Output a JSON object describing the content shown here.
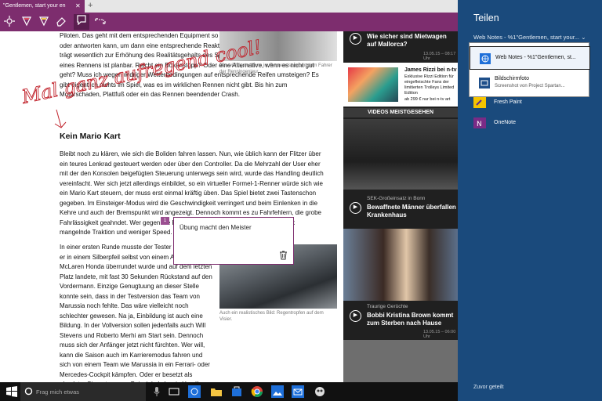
{
  "browser": {
    "tab_title": "\"Gentlemen, start your en",
    "tab_close": "✕",
    "new_tab": "+"
  },
  "toolbar": {
    "icons": [
      "pan-icon",
      "pen-icon",
      "highlighter-icon",
      "eraser-icon",
      "note-icon",
      "clip-icon"
    ]
  },
  "article": {
    "p1": "Piloten. Das geht mit dem entsprechenden Equipment so weit, dass der Spieler Fragen stellen oder antworten kann, um dann eine entsprechende Reaktion zu erhalten. Auch diese Interaktion trägt wesentlich zur Erhöhung des Realitätsgehalts des Spiels bei. Auch die Taktik während eines Rennens ist planbar. Reicht ein Boxenstopp? Oder eine Alternative, wenn es nicht gut geht? Muss ich wegen widriger Wetterbedingungen auf entsprechende Reifen umsteigen? Es gibt eigentlich nichts im Spiel, was es im wirklichen Rennen nicht gibt. Bis hin zum Motorschaden, Plattfuß oder ein das Rennen beendender Crash.",
    "h2": "Kein Mario Kart",
    "p2": "Bleibt noch zu klären, wie sich die Boliden fahren lassen. Nun, wie üblich kann der Flitzer über ein teures Lenkrad gesteuert werden oder über den Controller. Da die Mehrzahl der User eher mit der den Konsolen beigefügten Steuerung unterwegs sein wird, wurde das Handling deutlich vereinfacht. Wer sich jetzt allerdings einbildet, so ein virtueller Formel-1-Renner würde sich wie ein Mario Kart steuern, der muss erst einmal kräftig üben. Das Spiel bietet zwei Tastenschon gegeben. Im Einsteiger-Modus wird die Geschwindigkeit verringert und beim Einlenken in die Kehre und auch der Bremspunkt wird angezeigt. Dennoch kommt es zu Fahrfehlern, die grobe Fahrlässigkeit geahndet. Wer gegen die Regeln verstößt, wird bestraft. Das bedeutet mangelnde Traktion und weniger Speed.",
    "p3": "In einer ersten Runde musste der Tester erleben, wie er in einem Silberpfeil selbst von einem Alonso im McLaren Honda überrundet wurde und auf dem letzten Platz landete, mit fast 30 Sekunden Rückstand auf den Vordermann. Einzige Genugtuung an dieser Stelle konnte sein, dass in der Testversion das Team von Marussia noch fehlte. Das wäre vielleicht noch schlechter gewesen. Na ja, Einbildung ist auch eine Bildung. In der Vollversion sollen jedenfalls auch Will Stevens und Roberto Merhi am Start sein. Dennoch muss sich der Anfänger jetzt nicht fürchten. Wer will, kann die Saison auch im Karrieremodus fahren und sich von einem Team wie Marussia in ein Ferrari- oder Mercedes-Cockpit kämpfen. Oder er besetzt als absoluter Siegertyp, zum Beispiel als Lewis Hamilton, ein Spitzencockpit. Aber Achtung, auch hier hängt alles an den Fähigkeiten des Spielers. Ein Garant für den ersten Platz ist auch der Kader nicht.",
    "img_top_caption": "Der wichtigste Mann im Rennen ist neben dem Fahrer der Renningenieur.",
    "img_mid_caption": "Auch ein realistisches Bild: Regentropfen auf dem Visier."
  },
  "note": {
    "text": "Übung macht den Meister",
    "pin": "1"
  },
  "handwriting": "Mal ganz aufregend cool!",
  "news": [
    {
      "title": "Wie sicher sind Mietwagen auf Mallorca?",
      "time": "13.05.15 – 08:17 Uhr"
    },
    {
      "title": "James Rizzi bei n-tv",
      "sub": "Exklusive Rizzi Edition für eingefleischte Fans der limitierten Trolleys Limited Edition",
      "price": "ab 299 € nur bei n-tv art"
    },
    {
      "title": "VIDEOS MEISTGESEHEN"
    },
    {
      "kicker": "SEK-Großeinsatz in Bonn",
      "title": "Bewaffnete Männer überfallen Krankenhaus",
      "time": "13.05.15 – 08:20 Uhr"
    },
    {
      "kicker": "Traurige Gerüchte",
      "title": "Bobbi Kristina Brown kommt zum Sterben nach Hause",
      "time": "13.05.15 – 06:00 Uhr"
    }
  ],
  "share": {
    "title": "Teilen",
    "subtitle": "Web Notes - %1\"Gentlemen, start your...",
    "chevron": "⌄",
    "options": [
      {
        "title": "Web Notes - %1\"Gentlemen, st...",
        "sub": ""
      },
      {
        "title": "Bildschirmfoto",
        "sub": "Screenshot von Project Spartan..."
      }
    ],
    "apps": [
      "Fresh Paint",
      "OneNote"
    ],
    "footer": "Zuvor geteilt"
  },
  "taskbar": {
    "search_placeholder": "Frag mich etwas"
  },
  "colors": {
    "accent": "#7d2d6e",
    "share_bg": "#1a4a7c",
    "ink": "#c0212a"
  }
}
